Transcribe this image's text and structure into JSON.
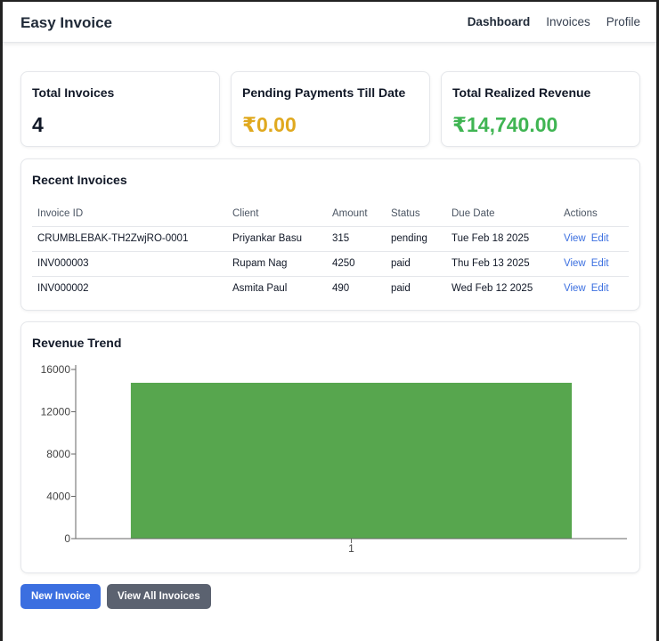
{
  "app": {
    "title": "Easy Invoice"
  },
  "nav": {
    "dashboard": "Dashboard",
    "invoices": "Invoices",
    "profile": "Profile"
  },
  "stats": {
    "total_invoices": {
      "label": "Total Invoices",
      "value": "4"
    },
    "pending": {
      "label": "Pending Payments Till Date",
      "value": "₹0.00",
      "color": "#e0a91f"
    },
    "revenue": {
      "label": "Total Realized Revenue",
      "value": "₹14,740.00",
      "color": "#40b553"
    }
  },
  "recent": {
    "title": "Recent Invoices",
    "headers": [
      "Invoice ID",
      "Client",
      "Amount",
      "Status",
      "Due Date",
      "Actions"
    ],
    "rows": [
      {
        "id": "CRUMBLEBAK-TH2ZwjRO-0001",
        "client": "Priyankar Basu",
        "amount": "315",
        "status": "pending",
        "due": "Tue Feb 18 2025",
        "view": "View",
        "edit": "Edit"
      },
      {
        "id": "INV000003",
        "client": "Rupam Nag",
        "amount": "4250",
        "status": "paid",
        "due": "Thu Feb 13 2025",
        "view": "View",
        "edit": "Edit"
      },
      {
        "id": "INV000002",
        "client": "Asmita Paul",
        "amount": "490",
        "status": "paid",
        "due": "Wed Feb 12 2025",
        "view": "View",
        "edit": "Edit"
      }
    ]
  },
  "trend": {
    "title": "Revenue Trend"
  },
  "chart_data": {
    "type": "bar",
    "categories": [
      "1"
    ],
    "values": [
      14740
    ],
    "ylim": [
      0,
      16000
    ],
    "yticks": [
      0,
      4000,
      8000,
      12000,
      16000
    ],
    "bar_color": "#57a64e",
    "grid": false
  },
  "actions": {
    "new_invoice": "New Invoice",
    "view_all": "View All Invoices"
  }
}
